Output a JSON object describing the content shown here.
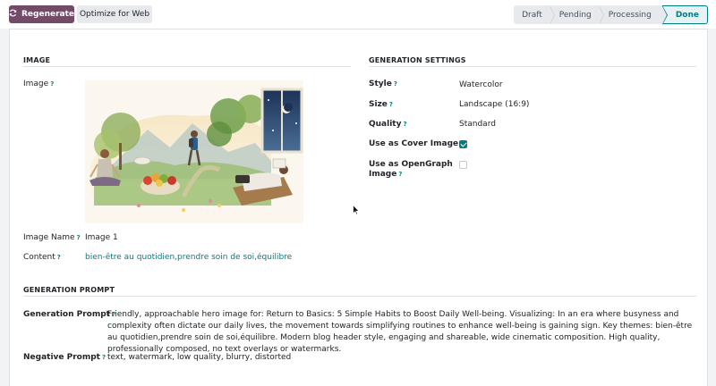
{
  "toolbar": {
    "regenerate_label": "Regenerate",
    "optimize_label": "Optimize for Web"
  },
  "statusbar": {
    "stages": [
      "Draft",
      "Pending",
      "Processing",
      "Done"
    ],
    "active": "Done"
  },
  "sections": {
    "image": "IMAGE",
    "settings": "GENERATION SETTINGS",
    "prompt": "GENERATION PROMPT"
  },
  "fields": {
    "image_label": "Image",
    "image_name_label": "Image Name",
    "image_name_value": "Image 1",
    "content_label": "Content",
    "content_value": "bien-être au quotidien,prendre soin de soi,équilibre",
    "style_label": "Style",
    "style_value": "Watercolor",
    "size_label": "Size",
    "size_value": "Landscape (16:9)",
    "quality_label": "Quality",
    "quality_value": "Standard",
    "cover_label": "Use as Cover Image",
    "cover_checked": true,
    "og_label_1": "Use as OpenGraph",
    "og_label_2": "Image",
    "og_checked": false,
    "prompt_label": "Generation Prompt",
    "prompt_value": "Friendly, approachable hero image for: Return to Basics: 5 Simple Habits to Boost Daily Well-being. Visualizing: In an era where busyness and complexity often dictate our daily lives, the movement towards simplifying routines to enhance well-being is gaining sign. Key themes: bien-être au quotidien,prendre soin de soi,équilibre. Modern blog header style, engaging and shareable, wide cinematic composition. High quality, professionally composed, no text overlays or watermarks.",
    "negative_label": "Negative Prompt",
    "negative_value": "text, watermark, low quality, blurry, distorted",
    "tooltip_mark": "?"
  },
  "colors": {
    "primary": "#714b67",
    "accent": "#017e84"
  },
  "icons": {
    "regenerate": "refresh-icon"
  }
}
